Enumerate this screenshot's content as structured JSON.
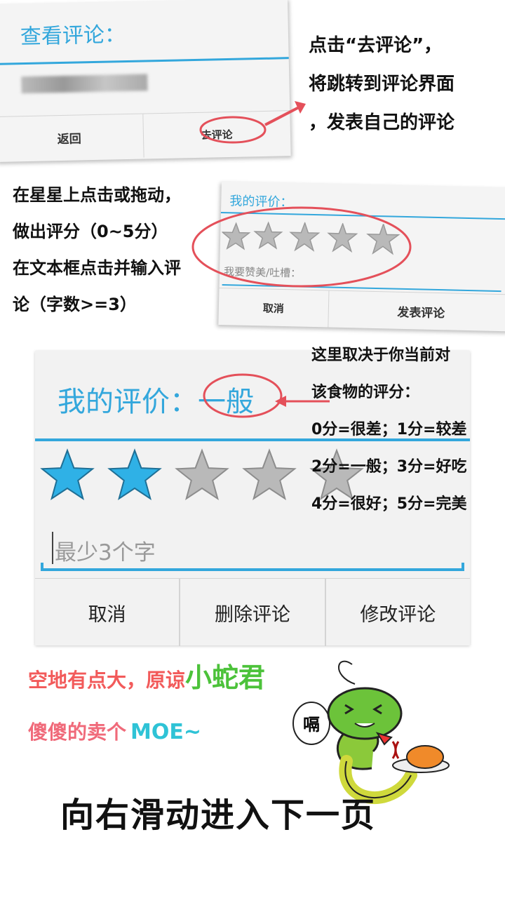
{
  "panel_view": {
    "title": "查看评论：",
    "back_label": "返回",
    "go_comment_label": "去评论"
  },
  "note_top": {
    "line1": "点击“去评论”，",
    "line2": "将跳转到评论界面",
    "line3": "，发表自己的评论"
  },
  "note_rate": {
    "line1": "在星星上点击或拖动，",
    "line2": "做出评分（0~5分）",
    "line3": "在文本框点击并输入评",
    "line4": "论（字数>=3）"
  },
  "panel_small": {
    "title": "我的评价：",
    "input_placeholder": "我要赞美/吐槽：",
    "cancel_label": "取消",
    "publish_label": "发表评论"
  },
  "panel_big": {
    "title": "我的评价：",
    "rating_word": "一般",
    "rating": 2,
    "max_rating": 5,
    "input_placeholder": "最少3个字",
    "buttons": [
      "取消",
      "删除评论",
      "修改评论"
    ]
  },
  "note_scale": {
    "line1": "这里取决于你当前对",
    "line2": "该食物的评分：",
    "line3": "0分=很差；1分=较差",
    "line4": "2分=一般；3分=好吃",
    "line5": "4分=很好；5分=完美"
  },
  "footer": {
    "apology_a": "空地有点大，原谅",
    "apology_b": "小蛇君",
    "moe_a": "傻傻的卖个",
    "moe_b": "MOE~",
    "swipe": "向右滑动进入下一页",
    "bubble": "嗝"
  },
  "colors": {
    "accent": "#33a7dc",
    "star_filled": "#2fb1e6",
    "star_empty": "#b9b9b9",
    "annotation_red": "#e4505a",
    "footer_red": "#f25a5a",
    "footer_green": "#4cc23a",
    "footer_pink": "#f06a7a",
    "footer_cyan": "#2fc3d6"
  }
}
